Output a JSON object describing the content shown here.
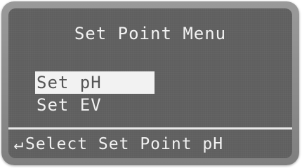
{
  "screen": {
    "title": "Set Point Menu",
    "menu": {
      "items": [
        {
          "label": "Set pH",
          "selected": true
        },
        {
          "label": "Set EV",
          "selected": false
        }
      ]
    },
    "footer": {
      "icon": "enter-arrow-icon",
      "icon_glyph": "↵",
      "text": "Select Set Point pH"
    }
  },
  "colors": {
    "bezel": "#8a8a8a",
    "lcd_background": "#5f5f5f",
    "lcd_text": "#f2f2f2",
    "highlight_text": "#555555"
  }
}
